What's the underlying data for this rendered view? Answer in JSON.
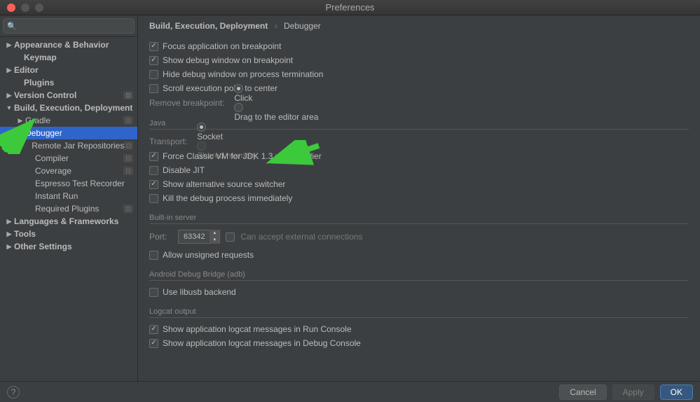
{
  "window": {
    "title": "Preferences"
  },
  "search": {
    "placeholder": ""
  },
  "sidebar": {
    "items": [
      {
        "label": "Appearance & Behavior",
        "arrow": "▶",
        "indent": 6,
        "bold": true
      },
      {
        "label": "Keymap",
        "arrow": "",
        "indent": 20,
        "bold": true
      },
      {
        "label": "Editor",
        "arrow": "▶",
        "indent": 6,
        "bold": true
      },
      {
        "label": "Plugins",
        "arrow": "",
        "indent": 20,
        "bold": true
      },
      {
        "label": "Version Control",
        "arrow": "▶",
        "indent": 6,
        "bold": true,
        "badge": true
      },
      {
        "label": "Build, Execution, Deployment",
        "arrow": "▼",
        "indent": 6,
        "bold": true
      },
      {
        "label": "Gradle",
        "arrow": "▶",
        "indent": 22,
        "badge": true
      },
      {
        "label": "Debugger",
        "arrow": "▶",
        "indent": 22,
        "selected": true
      },
      {
        "label": "Remote Jar Repositories",
        "arrow": "",
        "indent": 36,
        "badge": true
      },
      {
        "label": "Compiler",
        "arrow": "",
        "indent": 36,
        "badge": true
      },
      {
        "label": "Coverage",
        "arrow": "",
        "indent": 36,
        "badge": true
      },
      {
        "label": "Espresso Test Recorder",
        "arrow": "",
        "indent": 36
      },
      {
        "label": "Instant Run",
        "arrow": "",
        "indent": 36
      },
      {
        "label": "Required Plugins",
        "arrow": "",
        "indent": 36,
        "badge": true
      },
      {
        "label": "Languages & Frameworks",
        "arrow": "▶",
        "indent": 6,
        "bold": true
      },
      {
        "label": "Tools",
        "arrow": "▶",
        "indent": 6,
        "bold": true
      },
      {
        "label": "Other Settings",
        "arrow": "▶",
        "indent": 6,
        "bold": true
      }
    ]
  },
  "breadcrumb": {
    "path": "Build, Execution, Deployment",
    "leaf": "Debugger"
  },
  "general": {
    "checks": [
      {
        "label": "Focus application on breakpoint",
        "checked": true
      },
      {
        "label": "Show debug window on breakpoint",
        "checked": true
      },
      {
        "label": "Hide debug window on process termination",
        "checked": false
      },
      {
        "label": "Scroll execution point to center",
        "checked": false
      }
    ],
    "remove_label": "Remove breakpoint:",
    "remove_opts": [
      {
        "label": "Click",
        "selected": true
      },
      {
        "label": "Drag to the editor area",
        "selected": false
      }
    ]
  },
  "java": {
    "title": "Java",
    "transport_label": "Transport:",
    "transport_opts": [
      {
        "label": "Socket",
        "selected": true
      },
      {
        "label": "Shared memory",
        "selected": false,
        "disabled": true
      }
    ],
    "checks": [
      {
        "label": "Force Classic VM for JDK 1.3.x and earlier",
        "checked": true
      },
      {
        "label": "Disable JIT",
        "checked": false
      },
      {
        "label": "Show alternative source switcher",
        "checked": true
      },
      {
        "label": "Kill the debug process immediately",
        "checked": false
      }
    ]
  },
  "server": {
    "title": "Built-in server",
    "port_label": "Port:",
    "port_value": "63342",
    "external_label": "Can accept external connections",
    "allow_label": "Allow unsigned requests"
  },
  "adb": {
    "title": "Android Debug Bridge (adb)",
    "libusb_label": "Use libusb backend"
  },
  "logcat": {
    "title": "Logcat output",
    "checks": [
      {
        "label": "Show application logcat messages in Run Console",
        "checked": true
      },
      {
        "label": "Show application logcat messages in Debug Console",
        "checked": true
      }
    ]
  },
  "footer": {
    "cancel": "Cancel",
    "apply": "Apply",
    "ok": "OK"
  }
}
